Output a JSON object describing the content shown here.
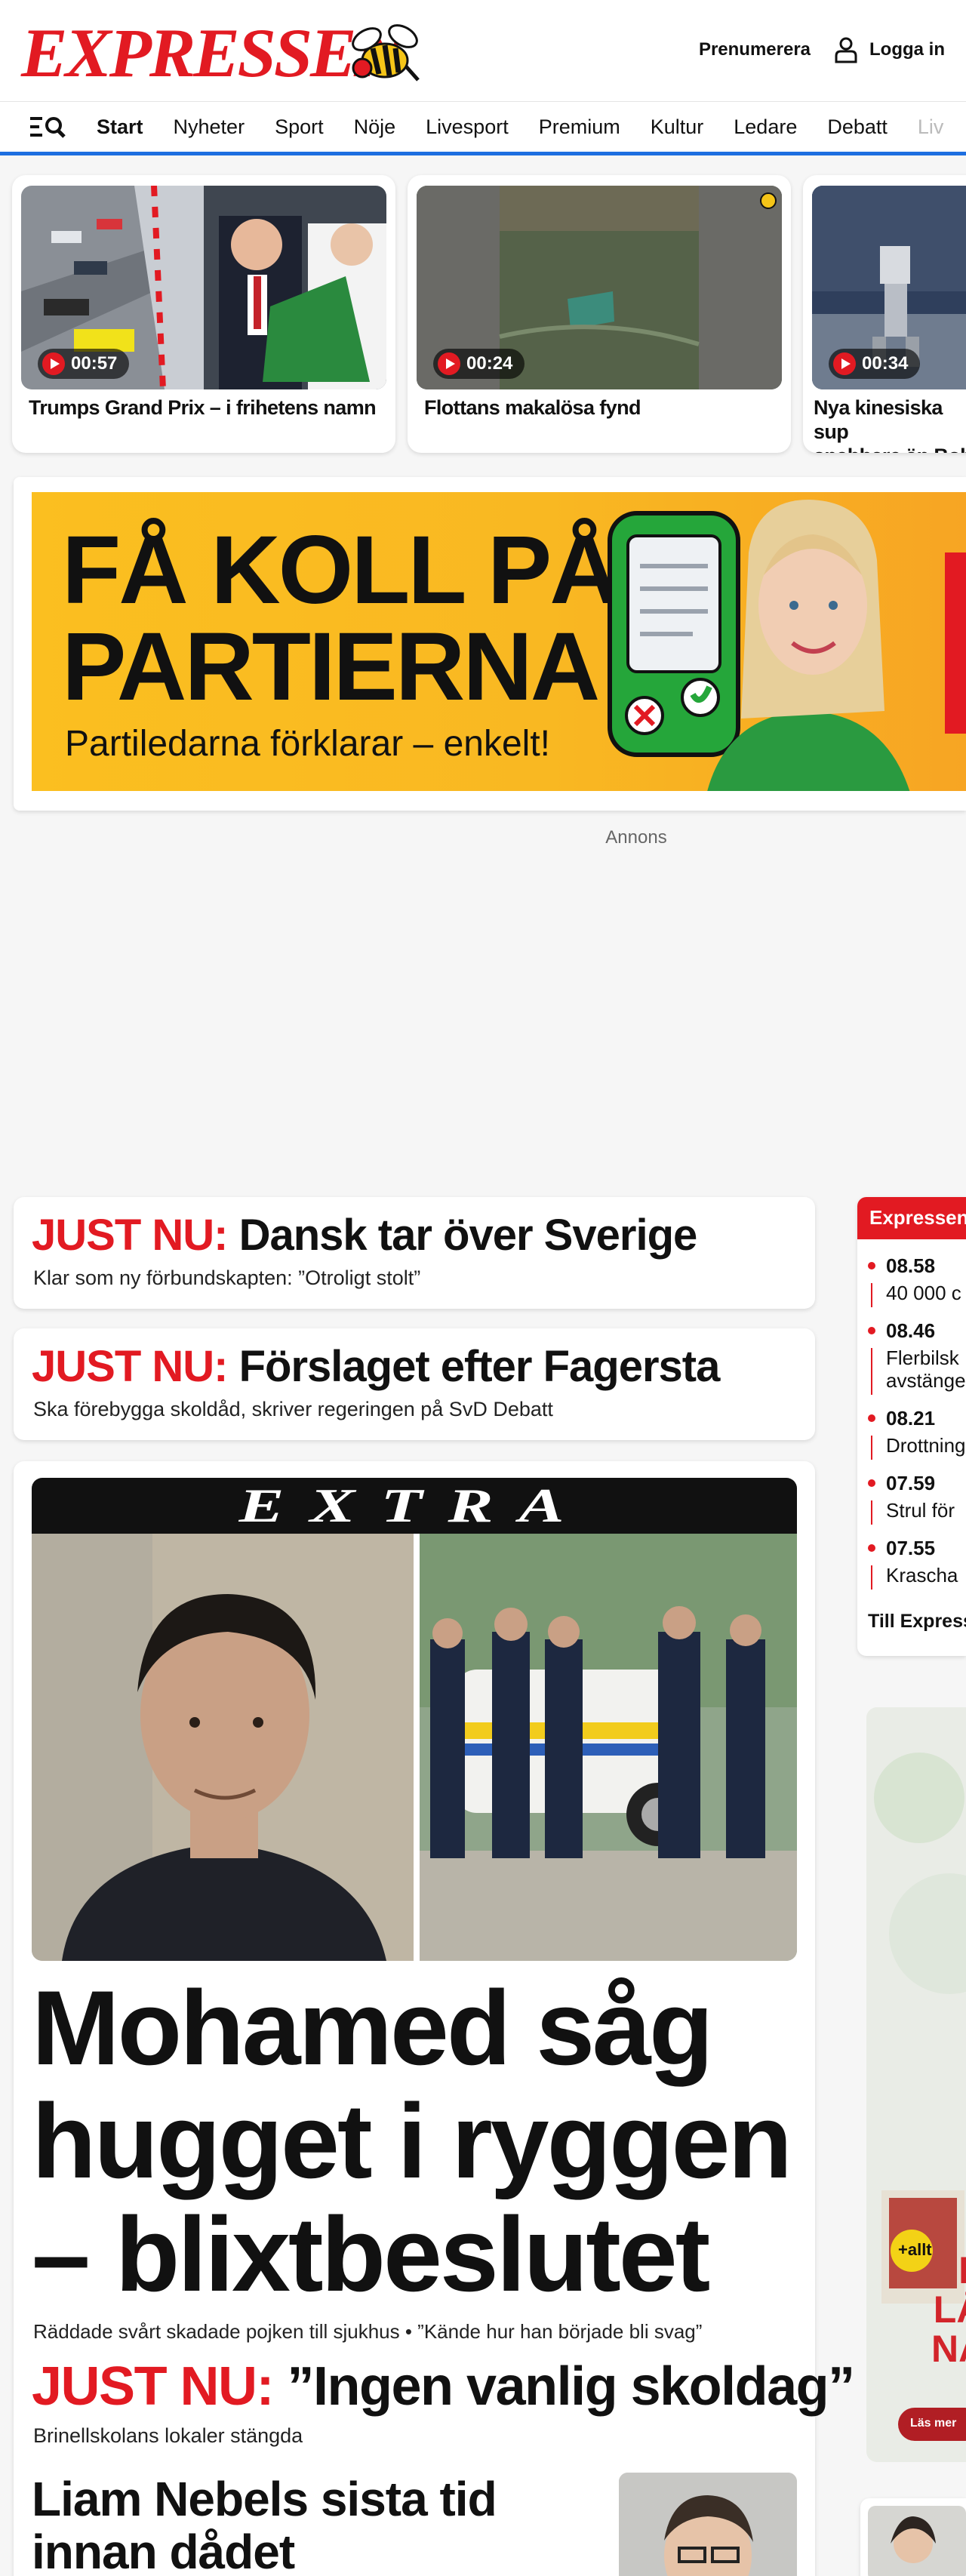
{
  "header": {
    "logo": "EXPRESSEN",
    "subscribe_label": "Prenumerera",
    "login_label": "Logga in"
  },
  "nav": {
    "items": [
      "Start",
      "Nyheter",
      "Sport",
      "Nöje",
      "Livesport",
      "Premium",
      "Kultur",
      "Ledare",
      "Debatt",
      "Liv"
    ]
  },
  "videos": [
    {
      "duration": "00:57",
      "title": "Trumps Grand Prix – i frihetens namn"
    },
    {
      "duration": "00:24",
      "title": "Flottans makalösa fynd"
    },
    {
      "duration": "00:34",
      "title_line1": "Nya kinesiska sup",
      "title_line2": "snabbare än Bolt"
    }
  ],
  "ad": {
    "headline_line1": "FÅ KOLL PÅ",
    "headline_line2": "PARTIERNA",
    "subline": "Partiledarna förklarar – enkelt!",
    "label": "Annons"
  },
  "main": {
    "just_nu_label": "JUST NU:",
    "news1": {
      "title": "Dansk tar över Sverige",
      "sub": "Klar som ny förbundskapten: ”Otroligt stolt”"
    },
    "news2": {
      "title": "Förslaget efter Fagersta",
      "sub": "Ska förebygga skoldåd, skriver regeringen på SvD Debatt"
    },
    "extra": {
      "banner": "EXTRA",
      "headline_line1": "Mohamed såg",
      "headline_line2": "hugget i ryggen",
      "headline_line3": "– blixtbeslutet",
      "sub": "Räddade svårt skadade pojken till sjukhus • ”Kände hur han började bli svag”",
      "just_title": "”Ingen vanlig skoldag”",
      "just_sub": "Brinellskolans lokaler stängda",
      "liam_line1": "Liam Nebels sista tid",
      "liam_line2": "innan dådet"
    }
  },
  "live": {
    "title": "Expressen Live",
    "items": [
      {
        "time": "08.58",
        "text": "40 000 c"
      },
      {
        "time": "08.46",
        "text_line1": "Flerbilsk",
        "text_line2": "avstänge"
      },
      {
        "time": "08.21",
        "text": "Drottning"
      },
      {
        "time": "07.59",
        "text": "Strul för"
      },
      {
        "time": "07.55",
        "text": "Krascha"
      }
    ],
    "link": "Till Express"
  },
  "side_ad": {
    "brand": "+allt",
    "text_line1": "H",
    "text_line2": "LÅN",
    "text_line3": "NÄR",
    "button": "Läs mer"
  },
  "colors": {
    "brand_red": "#e21a22",
    "nav_blue": "#1d6fe0",
    "ad_yellow": "#fbbf20"
  }
}
